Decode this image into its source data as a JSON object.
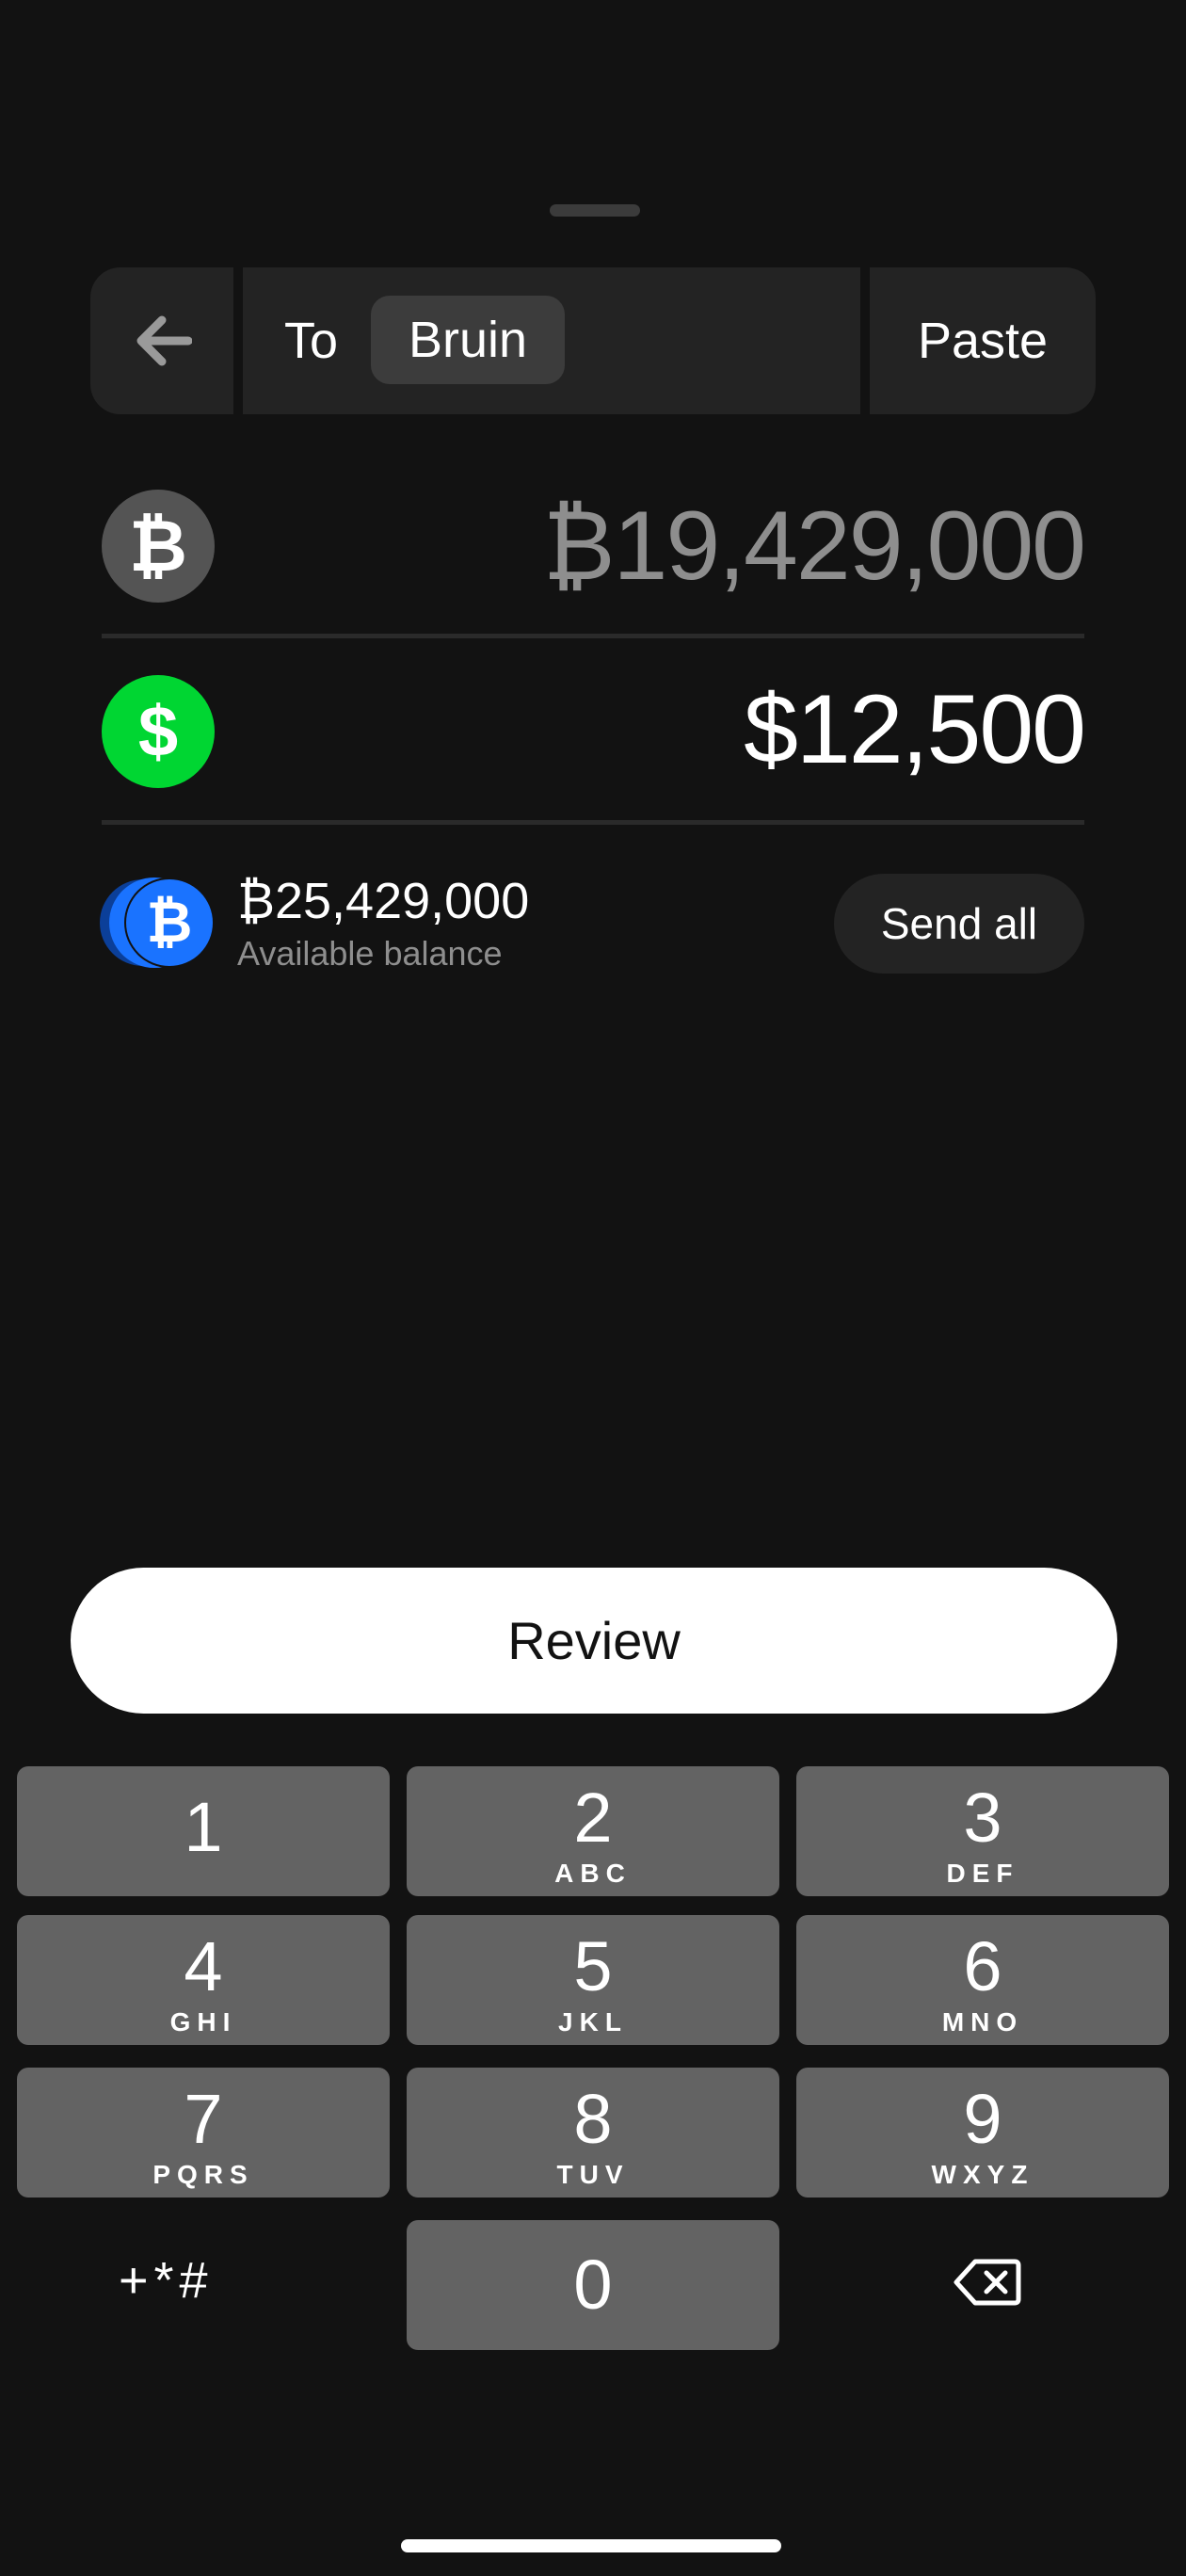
{
  "header": {
    "back_icon": "arrow-left-icon",
    "to_label": "To",
    "recipient": "Bruin",
    "paste_label": "Paste"
  },
  "btc_row": {
    "icon": "bitcoin-icon",
    "symbol": "₿",
    "amount": "₿19,429,000",
    "color": "#8e8e8e",
    "coin_color": "#545454"
  },
  "usd_row": {
    "icon": "dollar-icon",
    "symbol": "$",
    "amount": "$12,500",
    "color": "#ffffff",
    "coin_color": "#00d632"
  },
  "balance": {
    "icon": "bitcoin-wallet-icon",
    "amount": "₿25,429,000",
    "label": "Available balance",
    "send_all_label": "Send all",
    "coin_color": "#1a73ff"
  },
  "review_label": "Review",
  "keypad": {
    "keys": [
      {
        "num": "1",
        "letters": ""
      },
      {
        "num": "2",
        "letters": "ABC"
      },
      {
        "num": "3",
        "letters": "DEF"
      },
      {
        "num": "4",
        "letters": "GHI"
      },
      {
        "num": "5",
        "letters": "JKL"
      },
      {
        "num": "6",
        "letters": "MNO"
      },
      {
        "num": "7",
        "letters": "PQRS"
      },
      {
        "num": "8",
        "letters": "TUV"
      },
      {
        "num": "9",
        "letters": "WXYZ"
      },
      {
        "num": "0",
        "letters": ""
      }
    ],
    "symbols_label": "+*#",
    "delete_icon": "backspace-icon"
  }
}
